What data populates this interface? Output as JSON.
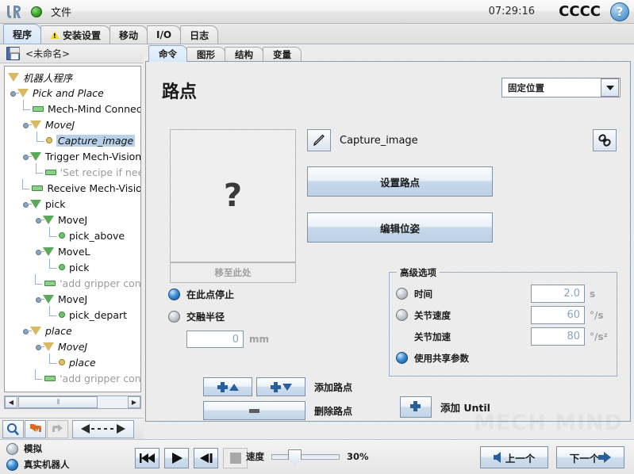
{
  "titlebar": {
    "logo_text": "UR",
    "globe_icon": "globe-icon",
    "file_menu": "文件",
    "clock": "07:29:16",
    "brand": "CCCC",
    "help_icon": "?"
  },
  "main_tabs": [
    {
      "label": "程序",
      "active": true,
      "warn": false
    },
    {
      "label": "安装设置",
      "active": false,
      "warn": true
    },
    {
      "label": "移动",
      "active": false,
      "warn": false
    },
    {
      "label": "I/O",
      "active": false,
      "warn": false
    },
    {
      "label": "日志",
      "active": false,
      "warn": false
    }
  ],
  "sidebar": {
    "save_icon": "save-icon",
    "program_name": "<未命名>",
    "tree": [
      {
        "label": "机器人程序",
        "depth": 0,
        "icon": "triangle-olive",
        "italic": true,
        "gray": false,
        "selected": false
      },
      {
        "label": "Pick and Place",
        "depth": 1,
        "icon": "triangle-olive",
        "italic": true,
        "gray": false,
        "selected": false
      },
      {
        "label": "Mech-Mind Connect",
        "depth": 2,
        "icon": "bar-green",
        "italic": false,
        "gray": false,
        "selected": false
      },
      {
        "label": "MoveJ",
        "depth": 2,
        "icon": "triangle-olive",
        "italic": true,
        "gray": false,
        "selected": false
      },
      {
        "label": "Capture_image",
        "depth": 3,
        "icon": "dot-olive",
        "italic": true,
        "gray": false,
        "selected": true
      },
      {
        "label": "Trigger Mech-Vision",
        "depth": 2,
        "icon": "triangle-green",
        "italic": false,
        "gray": false,
        "selected": false
      },
      {
        "label": "'Set recipe if nee",
        "depth": 3,
        "icon": "bar-green",
        "italic": false,
        "gray": true,
        "selected": false
      },
      {
        "label": "Receive Mech-Vision",
        "depth": 2,
        "icon": "bar-green",
        "italic": false,
        "gray": false,
        "selected": false
      },
      {
        "label": "pick",
        "depth": 2,
        "icon": "triangle-green",
        "italic": false,
        "gray": false,
        "selected": false
      },
      {
        "label": "MoveJ",
        "depth": 3,
        "icon": "triangle-green",
        "italic": false,
        "gray": false,
        "selected": false
      },
      {
        "label": "pick_above",
        "depth": 4,
        "icon": "dot-green",
        "italic": false,
        "gray": false,
        "selected": false
      },
      {
        "label": "MoveL",
        "depth": 3,
        "icon": "triangle-green",
        "italic": false,
        "gray": false,
        "selected": false
      },
      {
        "label": "pick",
        "depth": 4,
        "icon": "dot-green",
        "italic": false,
        "gray": false,
        "selected": false
      },
      {
        "label": "'add gripper cont",
        "depth": 3,
        "icon": "bar-green",
        "italic": false,
        "gray": true,
        "selected": false
      },
      {
        "label": "MoveJ",
        "depth": 3,
        "icon": "triangle-green",
        "italic": false,
        "gray": false,
        "selected": false
      },
      {
        "label": "pick_depart",
        "depth": 4,
        "icon": "dot-green",
        "italic": false,
        "gray": false,
        "selected": false
      },
      {
        "label": "place",
        "depth": 2,
        "icon": "triangle-olive",
        "italic": true,
        "gray": false,
        "selected": false
      },
      {
        "label": "MoveJ",
        "depth": 3,
        "icon": "triangle-olive",
        "italic": true,
        "gray": false,
        "selected": false
      },
      {
        "label": "place",
        "depth": 4,
        "icon": "dot-olive",
        "italic": true,
        "gray": false,
        "selected": false
      },
      {
        "label": "'add gripper cont",
        "depth": 3,
        "icon": "bar-green",
        "italic": false,
        "gray": true,
        "selected": false
      }
    ],
    "scrollbar": {
      "left_arrow": "◀",
      "right_arrow": "▶",
      "grip": "⦀"
    },
    "toolbar": {
      "search_icon": "search-icon",
      "undo_icon": "undo-icon",
      "redo_icon": "redo-icon",
      "move_icon": "move-left-right-icon"
    }
  },
  "sub_tabs": [
    {
      "label": "命令",
      "active": true
    },
    {
      "label": "图形",
      "active": false
    },
    {
      "label": "结构",
      "active": false
    },
    {
      "label": "变量",
      "active": false
    }
  ],
  "main": {
    "page_title": "路点",
    "position_type": {
      "value": "固定位置",
      "caret_icon": "chevron-down-icon"
    },
    "thumbnail": {
      "glyph": "?"
    },
    "move_here_button": "移至此处",
    "waypoint_name": "Capture_image",
    "edit_icon": "pencil-icon",
    "link_icon": "chain-link-icon",
    "set_waypoint_button": "设置路点",
    "edit_pose_button": "编辑位姿",
    "blend": {
      "stop_here_label": "在此点停止",
      "stop_here_selected": true,
      "blend_radius_label": "交融半径",
      "blend_radius_selected": false,
      "blend_radius_value": "0",
      "blend_radius_unit": "mm"
    },
    "advanced": {
      "legend": "高级选项",
      "rows": [
        {
          "label": "时间",
          "radio": true,
          "selected": false,
          "value": "2.0",
          "unit": "s"
        },
        {
          "label": "关节速度",
          "radio": true,
          "selected": false,
          "value": "60",
          "unit": "°/s"
        },
        {
          "label": "关节加速",
          "radio": false,
          "selected": false,
          "value": "80",
          "unit": "°/s²"
        },
        {
          "label": "使用共享参数",
          "radio": true,
          "selected": true,
          "value": "",
          "unit": ""
        }
      ]
    },
    "add_waypoint_label": "添加路点",
    "remove_waypoint_label": "删除路点",
    "add_until_label": "添加 Until",
    "add_until_icon": "plus-icon"
  },
  "statusbar": {
    "simulation_label": "模拟",
    "simulation_selected": false,
    "real_robot_label": "真实机器人",
    "real_robot_selected": true,
    "playback": {
      "prev_icon": "skip-back-icon",
      "play_icon": "play-icon",
      "next_icon": "skip-forward-icon",
      "stop_icon": "stop-icon"
    },
    "speed_label": "速度",
    "speed_value": "30%",
    "prev_button": "上一个",
    "next_button": "下一个"
  },
  "watermark": "MECH MIND"
}
